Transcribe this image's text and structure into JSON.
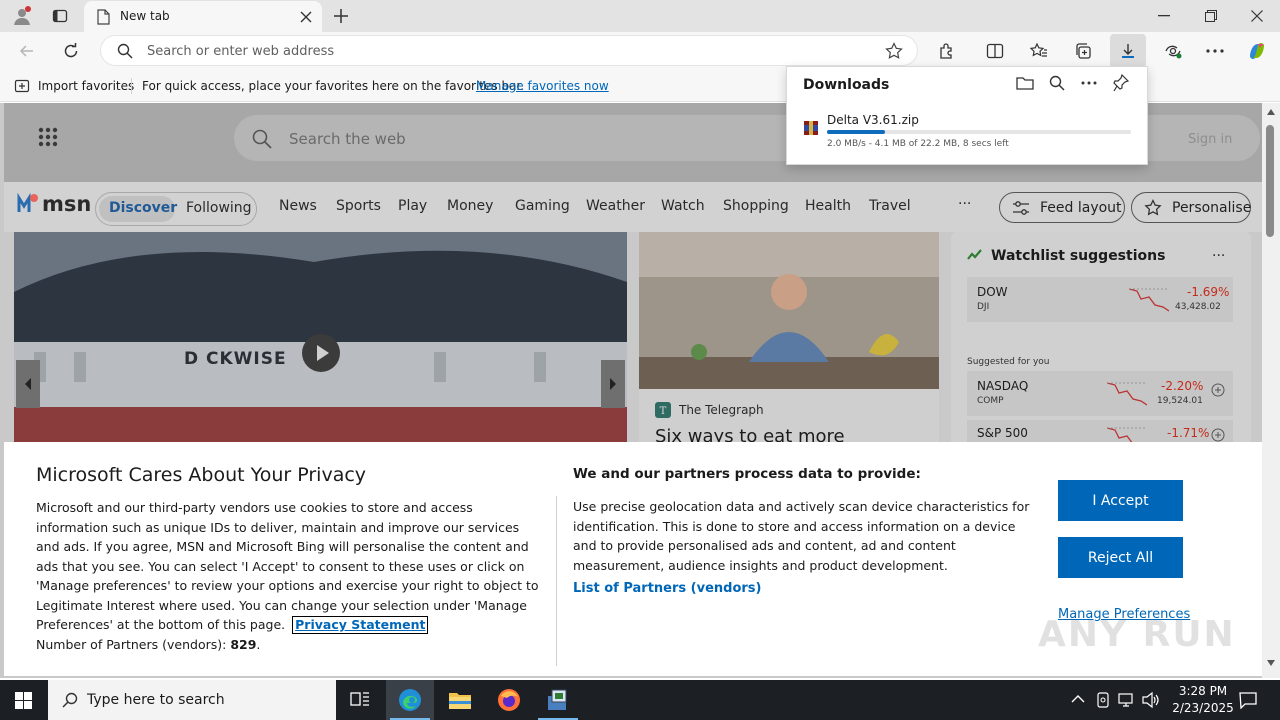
{
  "browser": {
    "tab_title": "New tab",
    "omnibox_placeholder": "Search or enter web address"
  },
  "favbar": {
    "import_label": "Import favorites",
    "hint_text": "For quick access, place your favorites here on the favorites bar.",
    "manage_link": "Manage favorites now"
  },
  "downloads": {
    "title": "Downloads",
    "file_name": "Delta V3.61.zip",
    "progress": 0.19,
    "status": "2.0 MB/s - 4.1 MB of 22.2 MB, 8 secs left"
  },
  "msn": {
    "search_placeholder": "Search the web",
    "sign_in": "Sign in",
    "logo_text": "msn",
    "nav": {
      "discover": "Discover",
      "following": "Following",
      "links": [
        "News",
        "Sports",
        "Play",
        "Money",
        "Gaming",
        "Weather",
        "Watch",
        "Shopping",
        "Health",
        "Travel"
      ],
      "more": "···",
      "feed_layout": "Feed layout",
      "personalise": "Personalise"
    },
    "hero_ship_text": "D CKWISE",
    "card": {
      "source": "The Telegraph",
      "headline": "Six ways to eat more"
    },
    "watchlist": {
      "title": "Watchlist suggestions",
      "more": "···",
      "suggested_label": "Suggested for you",
      "items": [
        {
          "name": "DOW",
          "sub": "DJI",
          "change": "-1.69%",
          "value": "43,428.02"
        },
        {
          "name": "NASDAQ",
          "sub": "COMP",
          "change": "-2.20%",
          "value": "19,524.01"
        },
        {
          "name": "S&P 500",
          "sub": "",
          "change": "-1.71%",
          "value": ""
        }
      ]
    }
  },
  "privacy": {
    "title": "Microsoft Cares About Your Privacy",
    "body": "Microsoft and our third-party vendors use cookies to store and access information such as unique IDs to deliver, maintain and improve our services and ads. If you agree, MSN and Microsoft Bing will personalise the content and ads that you see. You can select 'I Accept' to consent to these uses or click on 'Manage preferences' to review your options and exercise your right to object to Legitimate Interest where used.  You can change your selection under 'Manage Preferences' at the bottom of this page.",
    "privacy_link": "Privacy Statement",
    "partners_label": "Number of Partners (vendors):",
    "partners_count": "829",
    "partners_period": ".",
    "right_title": "We and our partners process data to provide:",
    "right_body": "Use precise geolocation data and actively scan device characteristics for identification. This is done to store and access information on a device and to provide personalised ads and content, ad and content measurement, audience insights and product development.",
    "list_link": "List of Partners (vendors)",
    "accept": "I Accept",
    "reject": "Reject All",
    "manage": "Manage Preferences"
  },
  "taskbar": {
    "search_placeholder": "Type here to search",
    "time": "3:28 PM",
    "date": "2/23/2025"
  },
  "watermark": "ANY RUN",
  "colors": {
    "accent": "#0067b8",
    "download_bar": "#0f6cbd",
    "negative": "#c42b1c"
  }
}
